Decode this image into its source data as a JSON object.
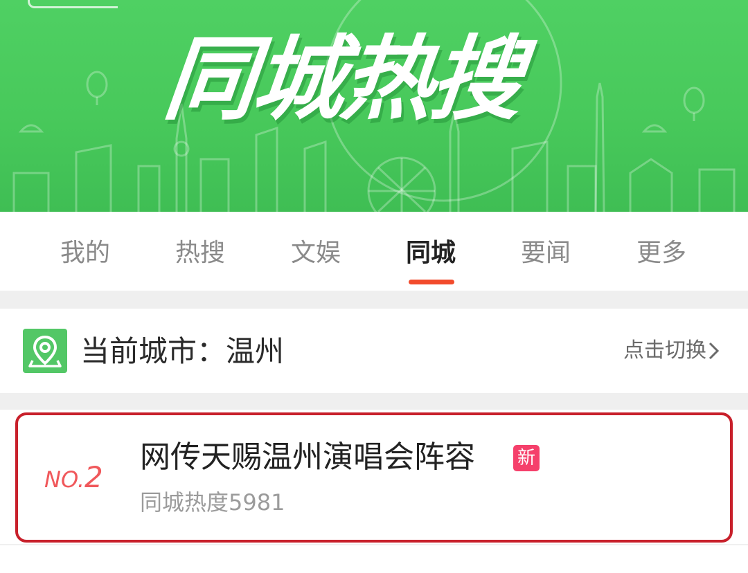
{
  "banner": {
    "title": "同城热搜",
    "colors": {
      "background": "#4cce60",
      "title": "#ffffff"
    }
  },
  "tabs": [
    {
      "label": "我的",
      "active": false
    },
    {
      "label": "热搜",
      "active": false
    },
    {
      "label": "文娱",
      "active": false
    },
    {
      "label": "同城",
      "active": true
    },
    {
      "label": "要闻",
      "active": false
    },
    {
      "label": "更多",
      "active": false
    }
  ],
  "tab_indicator_color": "#f24b2c",
  "city": {
    "icon": "location-pin-icon",
    "label": "当前城市：温州",
    "switch_label": "点击切换",
    "chevron_icon": "chevron-right-icon"
  },
  "hot_item": {
    "rank_prefix": "NO.",
    "rank_number": "2",
    "title": "网传天赐温州演唱会阵容",
    "badge": "新",
    "heat": "同城热度5981",
    "highlight_color": "#c8202b",
    "badge_color": "#f5406b"
  }
}
